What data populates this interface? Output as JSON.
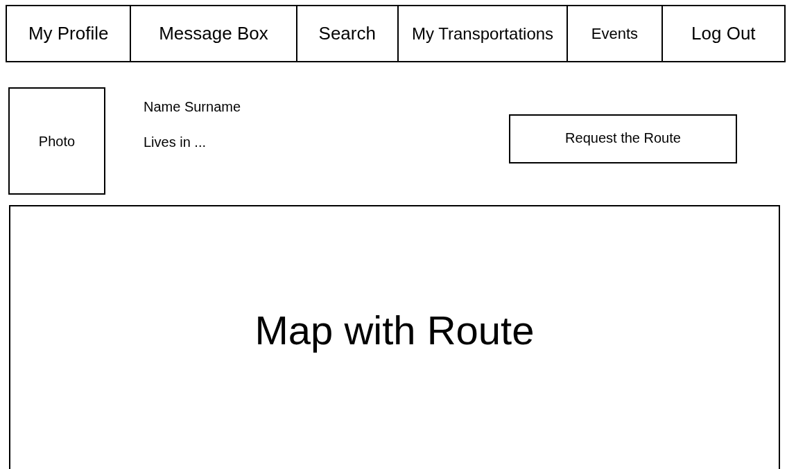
{
  "nav": [
    {
      "label": "My Profile"
    },
    {
      "label": "Message Box"
    },
    {
      "label": "Search"
    },
    {
      "label": "My Transportations"
    },
    {
      "label": "Events"
    },
    {
      "label": "Log Out"
    }
  ],
  "profile": {
    "photo_label": "Photo",
    "name": "Name Surname",
    "location": "Lives in ..."
  },
  "request_button": "Request the Route",
  "map": {
    "label": "Map with Route"
  }
}
